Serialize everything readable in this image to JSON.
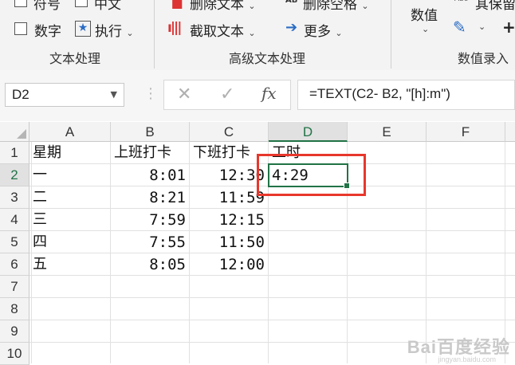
{
  "ribbon": {
    "text_group": {
      "items": [
        "符号",
        "中文",
        "数字",
        "执行"
      ],
      "label": "文本处理"
    },
    "advanced_group": {
      "items": [
        "删除文本",
        "截取文本",
        "删除空格",
        "更多"
      ],
      "label": "高级文本处理"
    },
    "value_group": {
      "items": [
        "数值",
        "其保留"
      ],
      "label": "数值录入"
    }
  },
  "formula_bar": {
    "name_box": "D2",
    "formula": "=TEXT(C2- B2, \"[h]:m\")"
  },
  "sheet": {
    "columns": [
      "A",
      "B",
      "C",
      "D",
      "E",
      "F"
    ],
    "rows": [
      "1",
      "2",
      "3",
      "4",
      "5",
      "6",
      "7",
      "8",
      "9",
      "10"
    ],
    "cells": {
      "r1": [
        "星期",
        "上班打卡",
        "下班打卡",
        "工时"
      ],
      "r2": [
        "一",
        "8:01",
        "12:30",
        "4:29"
      ],
      "r3": [
        "二",
        "8:21",
        "11:59"
      ],
      "r4": [
        "三",
        "7:59",
        "12:15"
      ],
      "r5": [
        "四",
        "7:55",
        "11:50"
      ],
      "r6": [
        "五",
        "8:05",
        "12:00"
      ]
    },
    "selected_cell": "D2"
  },
  "watermark": {
    "text": "Bai百度经验",
    "sub": "jingyan.baidu.com"
  },
  "colors": {
    "accent": "#217346",
    "highlight": "#e8372c"
  }
}
